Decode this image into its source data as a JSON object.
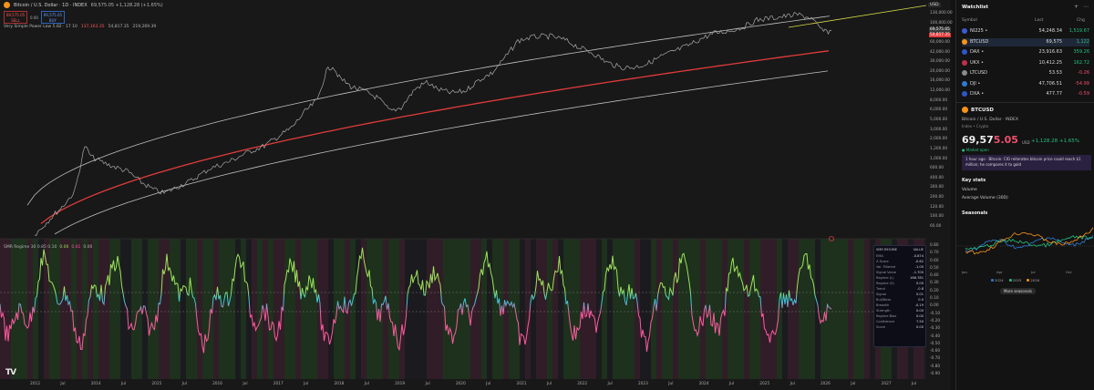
{
  "header": {
    "symbol_title": "Bitcoin / U.S. Dollar · 1D · INDEX",
    "ohlc": "69,575.05 +1,128.28 (+1.65%)",
    "sell_price": "69,575.05",
    "sell_label": "SELL",
    "mid": "0.00",
    "buy_price": "69,575.05",
    "buy_label": "BUY"
  },
  "indicator": {
    "name": "Very Simple Power Law 5.82 · 17 10",
    "v1": "137,163.35",
    "v2": "54,817.35",
    "v3": "219,269.39"
  },
  "oscillator": {
    "name": "SMR Regime 30 0.85 0.10",
    "v1": "0.00",
    "v2": "0.01",
    "v3": "0.00"
  },
  "price_axis": {
    "currency": "USD",
    "labels": [
      "130,000.00",
      "100,000.00",
      "80,000.00",
      "60,000.00",
      "42,000.00",
      "30,000.00",
      "20,000.00",
      "16,000.00",
      "12,000.00",
      "8,000.00",
      "6,000.00",
      "5,000.00",
      "3,000.00",
      "2,000.00",
      "1,200.00",
      "1,000.00",
      "600.00",
      "400.00",
      "300.00",
      "200.00",
      "120.00",
      "100.00",
      "60.00"
    ],
    "tags": [
      {
        "text": "69,575.05",
        "color": "#3a3a3a"
      },
      {
        "text": "54,817.35",
        "color": "#e23b3b"
      }
    ],
    "osc_labels": [
      "0.80",
      "0.70",
      "0.60",
      "0.50",
      "0.40",
      "0.30",
      "0.20",
      "0.10",
      "0.00",
      "-0.10",
      "-0.20",
      "-0.30",
      "-0.40",
      "-0.50",
      "-0.60",
      "-0.70",
      "-0.80",
      "-0.90"
    ]
  },
  "time_axis": {
    "labels": [
      "2012",
      "Jul",
      "2014",
      "Jul",
      "2015",
      "Jul",
      "2016",
      "Jul",
      "2017",
      "Jul",
      "2018",
      "Jul",
      "2019",
      "Jul",
      "2020",
      "Jul",
      "2021",
      "Jul",
      "2022",
      "Jul",
      "2023",
      "Jul",
      "2024",
      "Jul",
      "2025",
      "Jul",
      "2026",
      "Jul",
      "2027",
      "Jul"
    ]
  },
  "regime_table": {
    "title_left": "SMR REGIME",
    "title_right": "VALUE",
    "rows": [
      {
        "k": "EMA",
        "v": "-0.874"
      },
      {
        "k": "Z-Score",
        "v": "-0.62"
      },
      {
        "k": "Vol. Filtered",
        "v": "-1.00"
      },
      {
        "k": "Signal Value",
        "v": "-1.705"
      },
      {
        "k": "Regime (L)",
        "v": "166.781"
      },
      {
        "k": "Regime (S)",
        "v": "0.00"
      },
      {
        "k": "Trend",
        "v": "-0.8"
      },
      {
        "k": "Signal",
        "v": "0.01"
      },
      {
        "k": "Bull/Bear",
        "v": "0.0"
      },
      {
        "k": "Breadth",
        "v": "-0.19"
      },
      {
        "k": "Strength",
        "v": "0.00"
      },
      {
        "k": "Regime Bias",
        "v": "0.00"
      },
      {
        "k": "Confidence",
        "v": "7.50"
      },
      {
        "k": "Score",
        "v": "0.00"
      }
    ]
  },
  "watchlist": {
    "title": "Watchlist",
    "col_symbol": "Symbol",
    "col_last": "Last",
    "col_chg": "Chg",
    "rows": [
      {
        "sym": "NI225 •",
        "last": "54,248.34",
        "chg": "1,519.67",
        "dir": "pos",
        "color": "#3b5bd6"
      },
      {
        "sym": "BTCUSD",
        "last": "69,575",
        "chg": "1,122",
        "dir": "pos",
        "color": "#f7931a"
      },
      {
        "sym": "DAX •",
        "last": "23,916.63",
        "chg": "359.26",
        "dir": "pos",
        "color": "#2f56c9"
      },
      {
        "sym": "UKX •",
        "last": "10,412.25",
        "chg": "162.72",
        "dir": "pos",
        "color": "#c0304a"
      },
      {
        "sym": "LTCUSD",
        "last": "53.53",
        "chg": "-0.26",
        "dir": "neg",
        "color": "#8a8a8a"
      },
      {
        "sym": "DJI •",
        "last": "47,706.51",
        "chg": "-54.99",
        "dir": "neg",
        "color": "#2f7bd6"
      },
      {
        "sym": "DXA •",
        "last": "477.77",
        "chg": "-0.59",
        "dir": "neg",
        "color": "#2f56c9"
      }
    ]
  },
  "details": {
    "symbol": "BTCUSD",
    "name": "Bitcoin / U.S. Dollar · INDEX",
    "type": "Index • Crypto",
    "price_main": "69,57",
    "price_tail": "5.05",
    "currency": "USD",
    "change": "+1,128.28  +1.65%",
    "status": "● Market open",
    "news": "1 hour ago · Bitcoin: CIO reiterates bitcoin price could reach $1 million; he compares it to gold",
    "keystats": "Key stats",
    "volume": "Volume",
    "avg_volume": "Average Volume (30D)",
    "seasonals": "Seasonals",
    "season_x": [
      "Jan",
      "Apr",
      "Jul",
      "Oct"
    ],
    "season_legend": [
      {
        "label": "2024",
        "color": "#2f7bd6"
      },
      {
        "label": "2025",
        "color": "#26c281"
      },
      {
        "label": "2026",
        "color": "#f7931a"
      }
    ],
    "more_seasonals": "More seasonals"
  }
}
